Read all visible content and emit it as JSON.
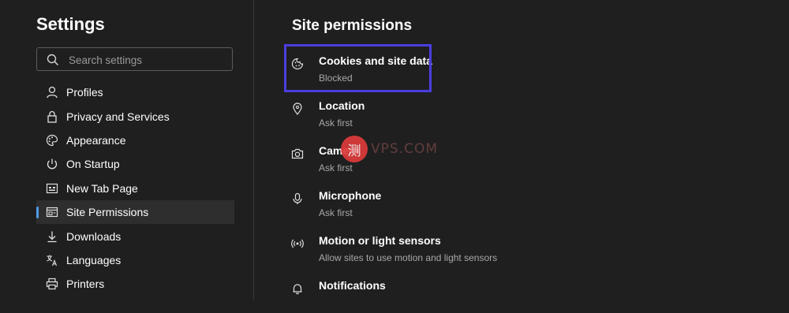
{
  "sidebar": {
    "title": "Settings",
    "search": {
      "placeholder": "Search settings",
      "value": ""
    },
    "items": [
      {
        "label": "Profiles",
        "icon": "profile-icon"
      },
      {
        "label": "Privacy and Services",
        "icon": "lock-icon"
      },
      {
        "label": "Appearance",
        "icon": "palette-icon"
      },
      {
        "label": "On Startup",
        "icon": "power-icon"
      },
      {
        "label": "New Tab Page",
        "icon": "newtab-icon"
      },
      {
        "label": "Site Permissions",
        "icon": "site-permissions-icon",
        "active": true
      },
      {
        "label": "Downloads",
        "icon": "download-icon"
      },
      {
        "label": "Languages",
        "icon": "languages-icon"
      },
      {
        "label": "Printers",
        "icon": "printer-icon"
      }
    ]
  },
  "main": {
    "title": "Site permissions",
    "permissions": [
      {
        "name": "Cookies and site data",
        "desc": "Blocked",
        "icon": "cookie-icon"
      },
      {
        "name": "Location",
        "desc": "Ask first",
        "icon": "location-pin-icon"
      },
      {
        "name": "Camera",
        "desc": "Ask first",
        "icon": "camera-icon"
      },
      {
        "name": "Microphone",
        "desc": "Ask first",
        "icon": "microphone-icon"
      },
      {
        "name": "Motion or light sensors",
        "desc": "Allow sites to use motion and light sensors",
        "icon": "sensor-icon"
      },
      {
        "name": "Notifications",
        "desc": "",
        "icon": "bell-icon"
      }
    ]
  },
  "watermark": {
    "badge": "测",
    "text": "VPS.COM"
  },
  "colors": {
    "background": "#1f1f1f",
    "accent": "#4f9be8",
    "highlight": "#4a3ee0"
  }
}
